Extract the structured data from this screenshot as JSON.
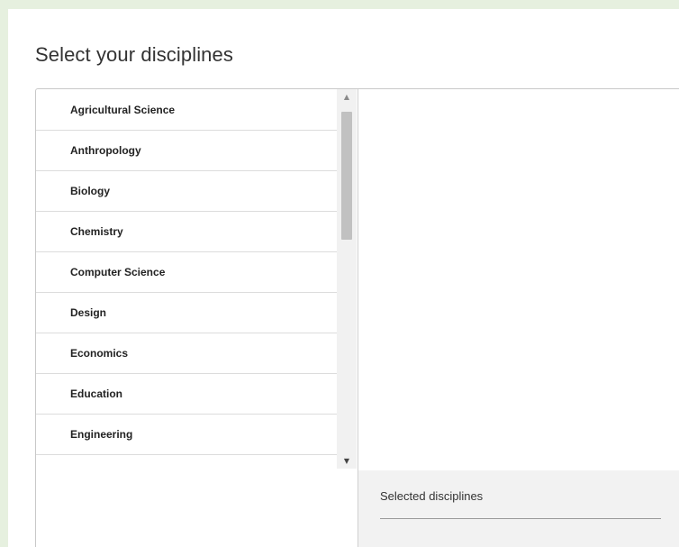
{
  "page": {
    "title": "Select your disciplines"
  },
  "disciplines": {
    "items": [
      "Agricultural Science",
      "Anthropology",
      "Biology",
      "Chemistry",
      "Computer Science",
      "Design",
      "Economics",
      "Education",
      "Engineering"
    ]
  },
  "scrollbar": {
    "up_icon": "scroll-up-arrow-icon",
    "down_icon": "scroll-down-arrow-icon",
    "up_glyph": "▲",
    "down_glyph": "▼"
  },
  "selected": {
    "label": "Selected disciplines"
  },
  "colors": {
    "outer_background": "#e6f0df",
    "panel_border": "#c8c8c8",
    "selected_background": "#f2f2f2"
  }
}
